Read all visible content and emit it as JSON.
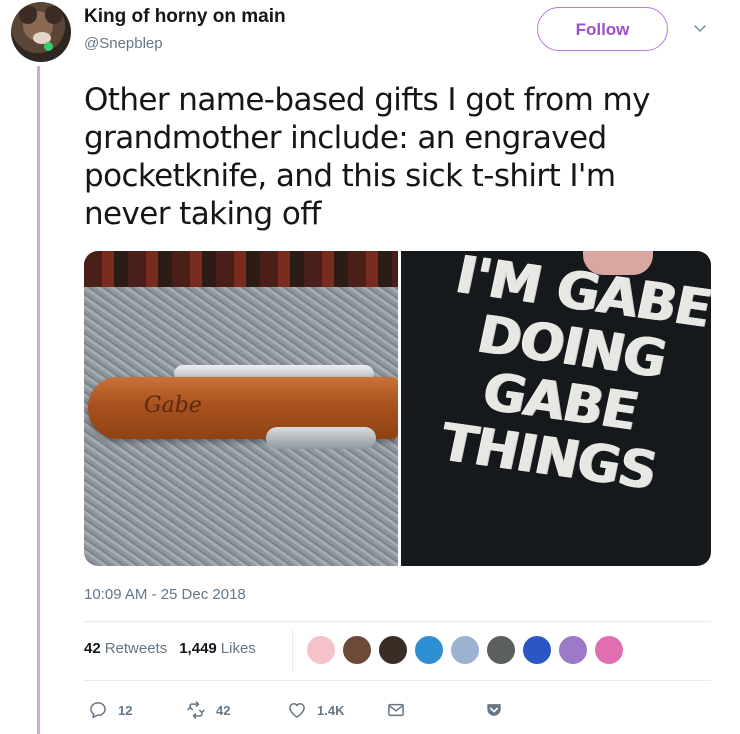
{
  "user": {
    "display_name": "King of horny on main",
    "handle": "@Snepblep"
  },
  "follow_label": "Follow",
  "tweet": {
    "text": "Other name-based gifts I got from my grandmother include: an engraved pocketknife, and this sick t-shirt I'm never taking off",
    "knife_engraving": "Gabe",
    "shirt_lines": [
      "I'M GABE",
      "DOING",
      "GABE",
      "THINGS"
    ],
    "timestamp": "10:09 AM - 25 Dec 2018"
  },
  "stats": {
    "retweets_count": "42",
    "retweets_label": "Retweets",
    "likes_count": "1,449",
    "likes_label": "Likes"
  },
  "liker_avatars": [
    {
      "name": "liker-avatar-1",
      "color": "#f3c3c9"
    },
    {
      "name": "liker-avatar-2",
      "color": "#6b4a3a"
    },
    {
      "name": "liker-avatar-3",
      "color": "#3a2d26"
    },
    {
      "name": "liker-avatar-4",
      "color": "#2f8fd3"
    },
    {
      "name": "liker-avatar-5",
      "color": "#9bb3d0"
    },
    {
      "name": "liker-avatar-6",
      "color": "#5b5f5e"
    },
    {
      "name": "liker-avatar-7",
      "color": "#2b57c5"
    },
    {
      "name": "liker-avatar-8",
      "color": "#9c79c9"
    },
    {
      "name": "liker-avatar-9",
      "color": "#e06fb0"
    }
  ],
  "actions": {
    "reply_count": "12",
    "retweet_count": "42",
    "like_count": "1.4K"
  },
  "colors": {
    "accent": "#9b4fc9",
    "thread_line": "#d3a6ea",
    "muted_text": "#657786"
  }
}
